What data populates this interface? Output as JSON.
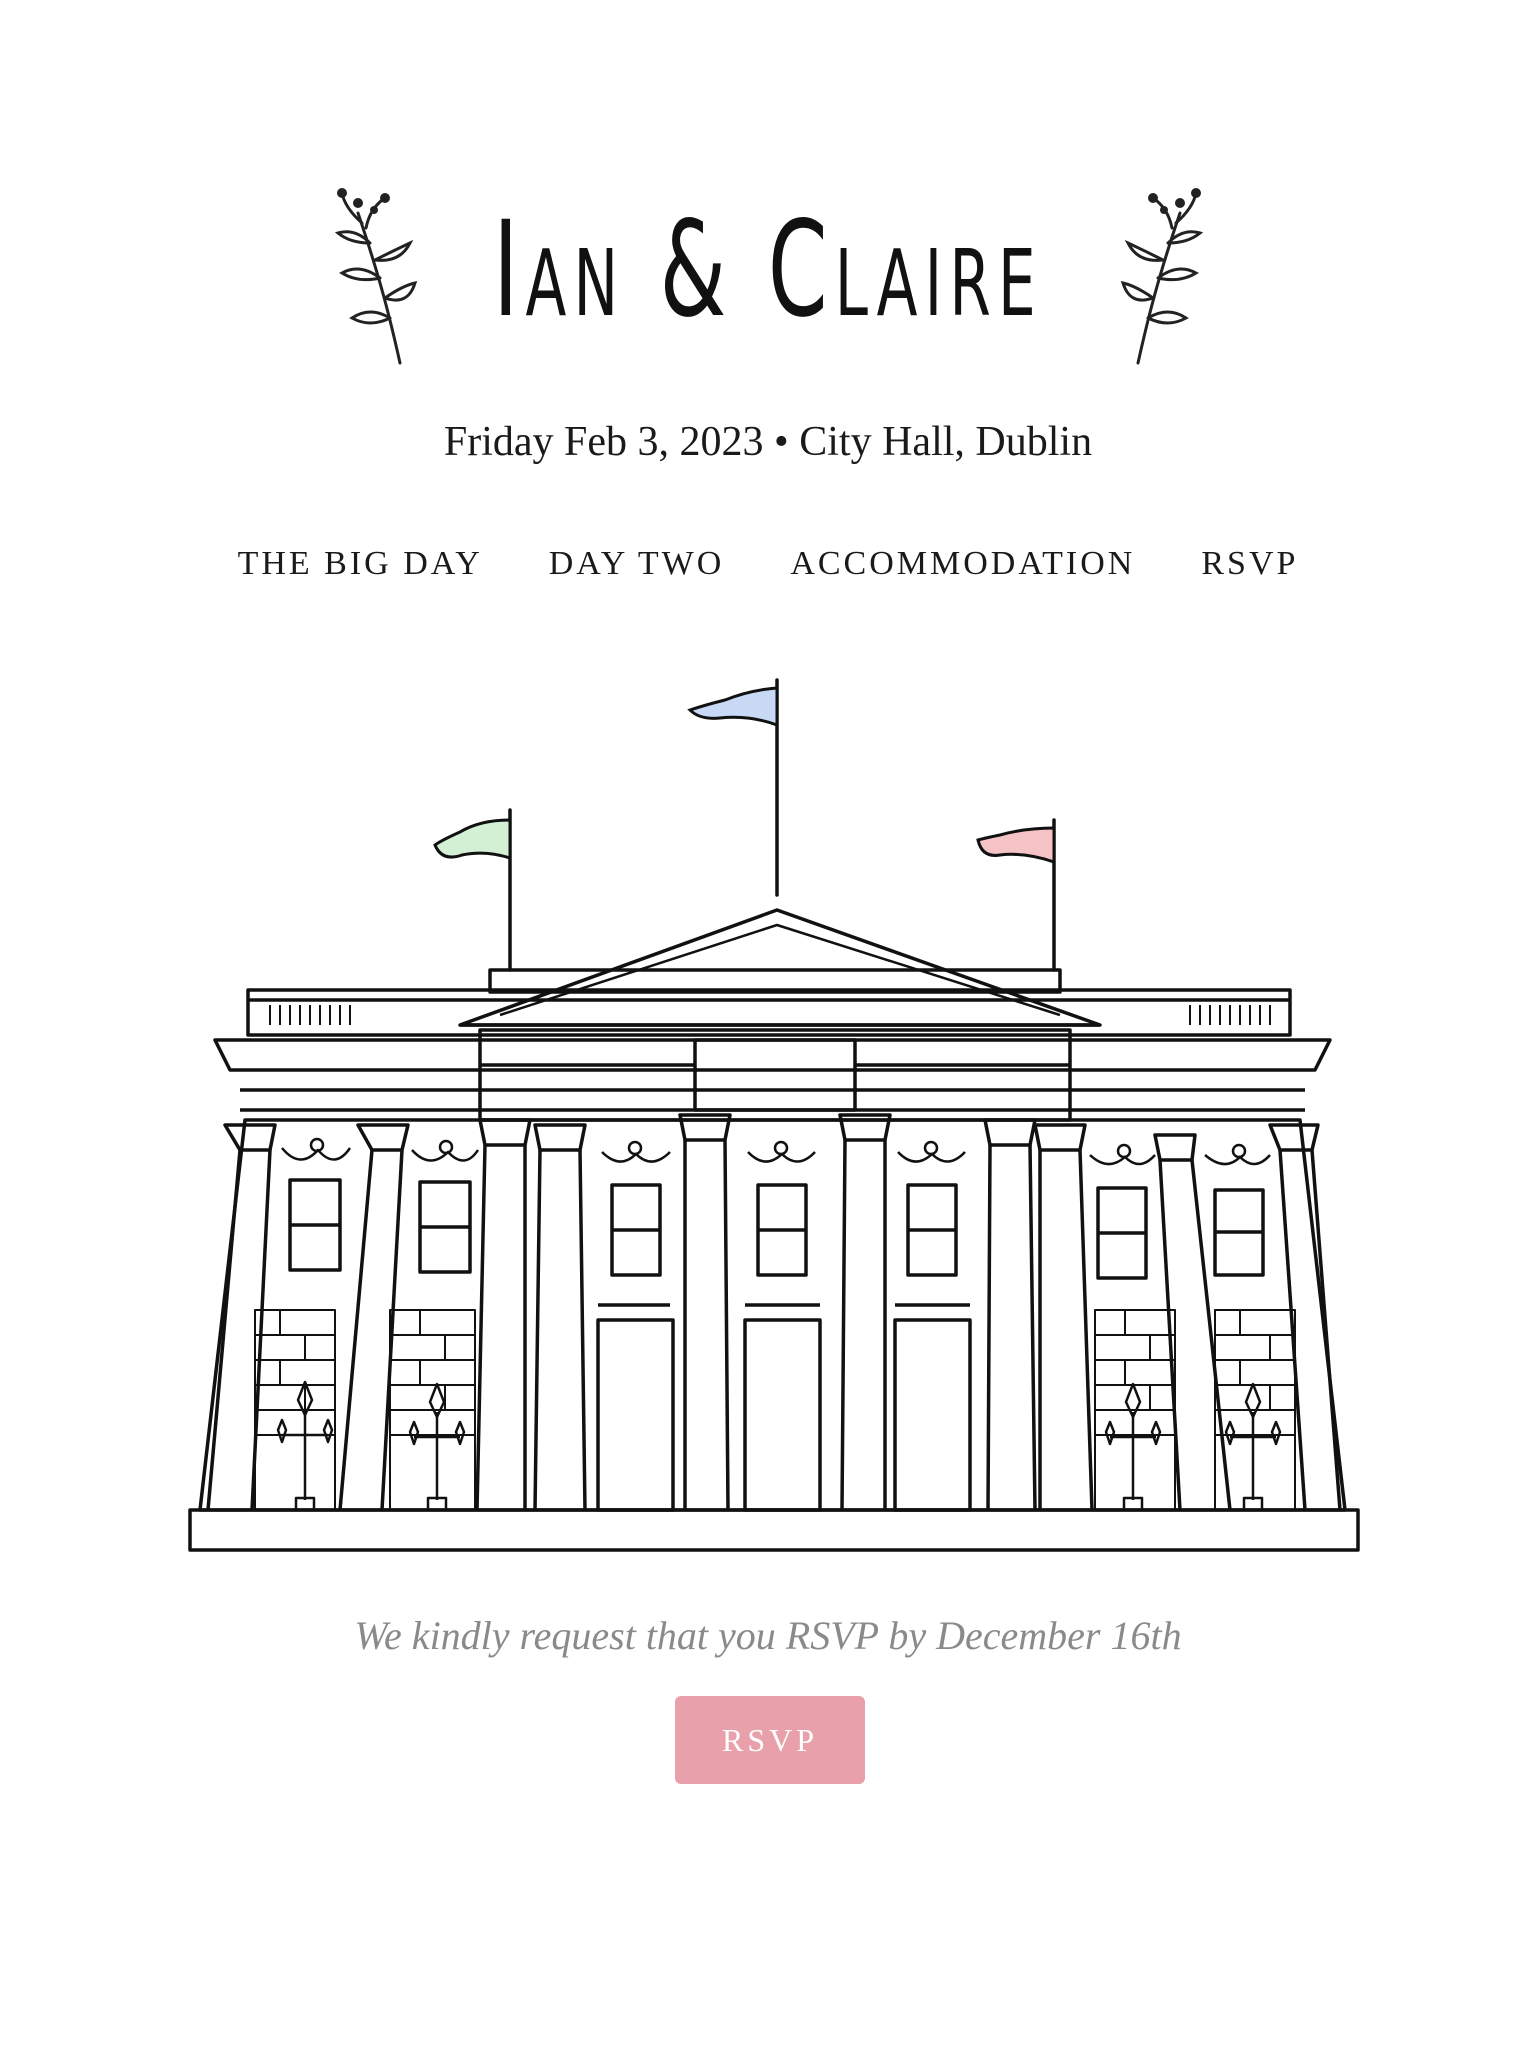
{
  "header": {
    "title": "Ian & Claire",
    "event_line": "Friday Feb 3, 2023 • City Hall, Dublin"
  },
  "nav": {
    "items": [
      {
        "label": "THE BIG DAY"
      },
      {
        "label": "DAY TWO"
      },
      {
        "label": "ACCOMMODATION"
      },
      {
        "label": "RSVP"
      }
    ]
  },
  "illustration": {
    "flag_colors": {
      "left": "#d4f0d4",
      "center": "#c8d9f5",
      "right": "#f5c2c6"
    }
  },
  "rsvp": {
    "note": "We kindly request that you RSVP by December 16th",
    "button_label": "RSVP"
  },
  "colors": {
    "accent": "#e8a0ab",
    "text": "#1a1a1a",
    "muted": "#8a8a8a"
  }
}
